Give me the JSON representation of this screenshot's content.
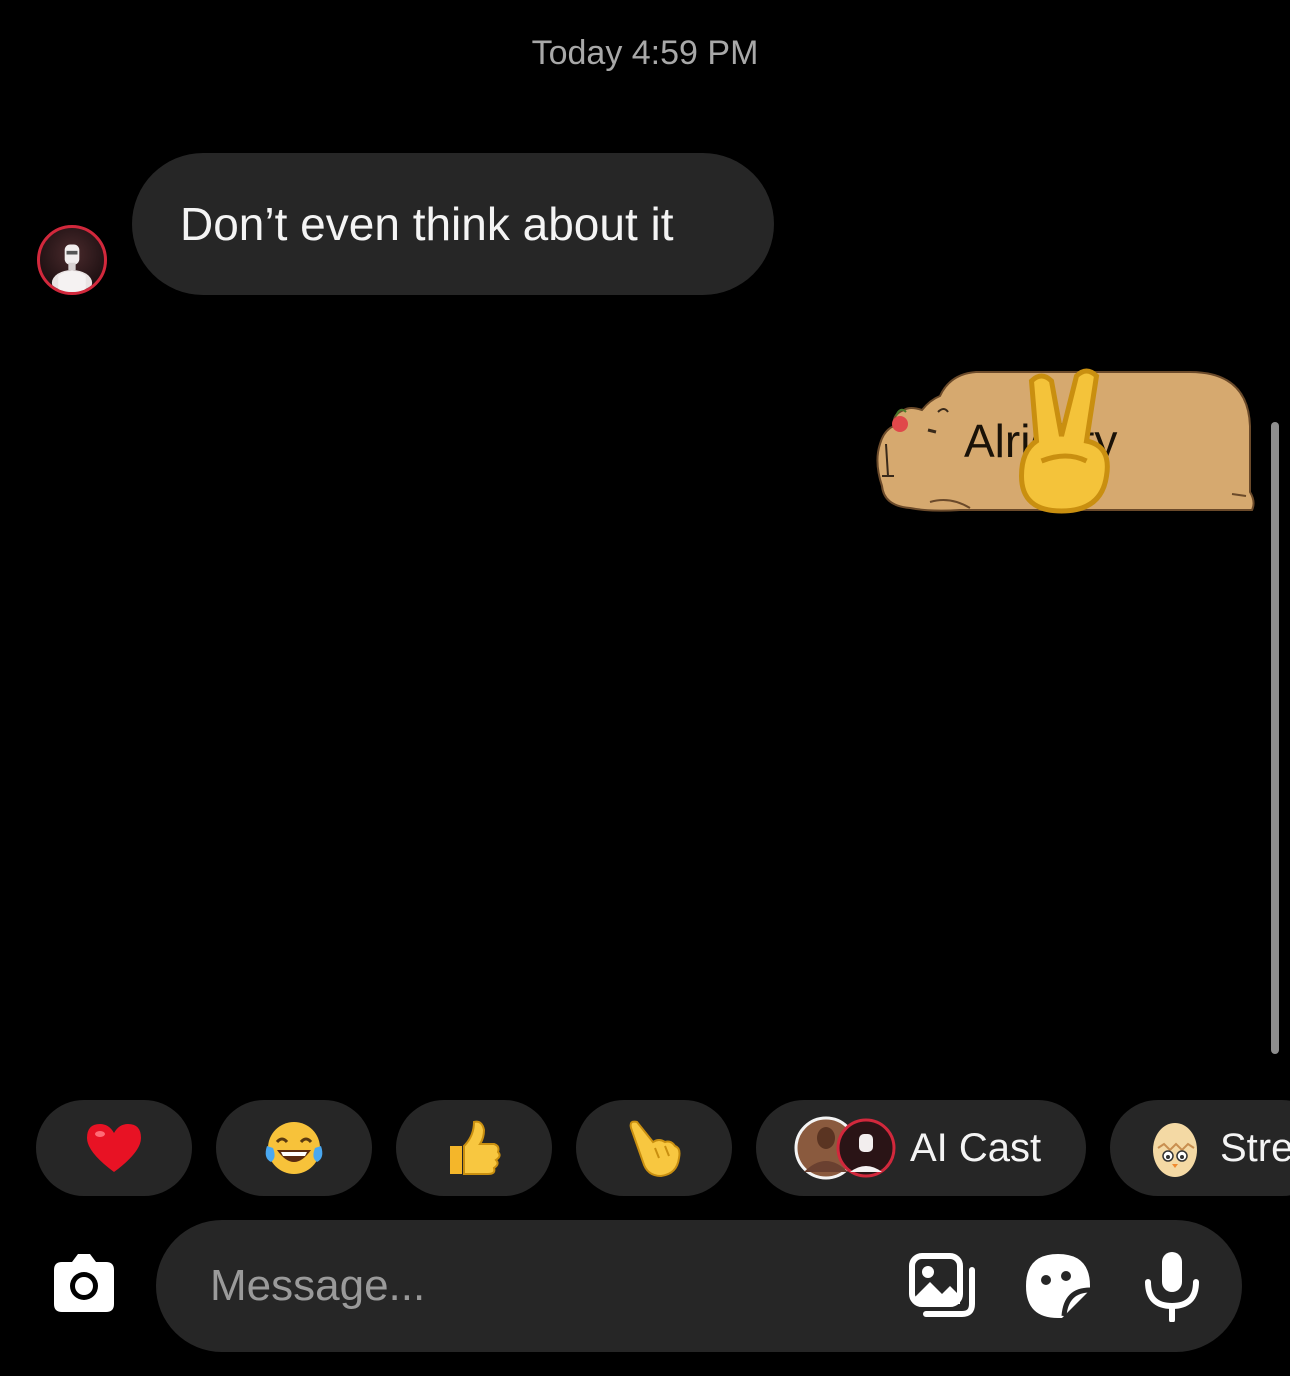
{
  "thread": {
    "timestamp": "Today 4:59 PM",
    "messages": [
      {
        "direction": "incoming",
        "text": "Don’t even think about it"
      },
      {
        "direction": "outgoing",
        "text": "Alrighty",
        "emoji_icon": "victory-hand-emoji",
        "bubble_style": "capybara-sticker"
      }
    ]
  },
  "quick_replies": [
    {
      "icon": "red-heart-emoji"
    },
    {
      "icon": "tears-of-joy-emoji"
    },
    {
      "icon": "thumbs-up-emoji"
    },
    {
      "icon": "pointing-hand-emoji"
    },
    {
      "icon": "ai-cast-avatars",
      "label": "AI Cast"
    },
    {
      "icon": "egg-chick-emoji",
      "label": "Stre"
    }
  ],
  "composer": {
    "placeholder": "Message...",
    "value": "",
    "icons": [
      "camera-icon",
      "gallery-icon",
      "sticker-icon",
      "microphone-icon"
    ]
  },
  "colors": {
    "background": "#000000",
    "bubble": "#262626",
    "sticker_fill": "#d6a96f",
    "avatar_ring": "#d2283c",
    "timestamp": "#a8a8a8"
  }
}
